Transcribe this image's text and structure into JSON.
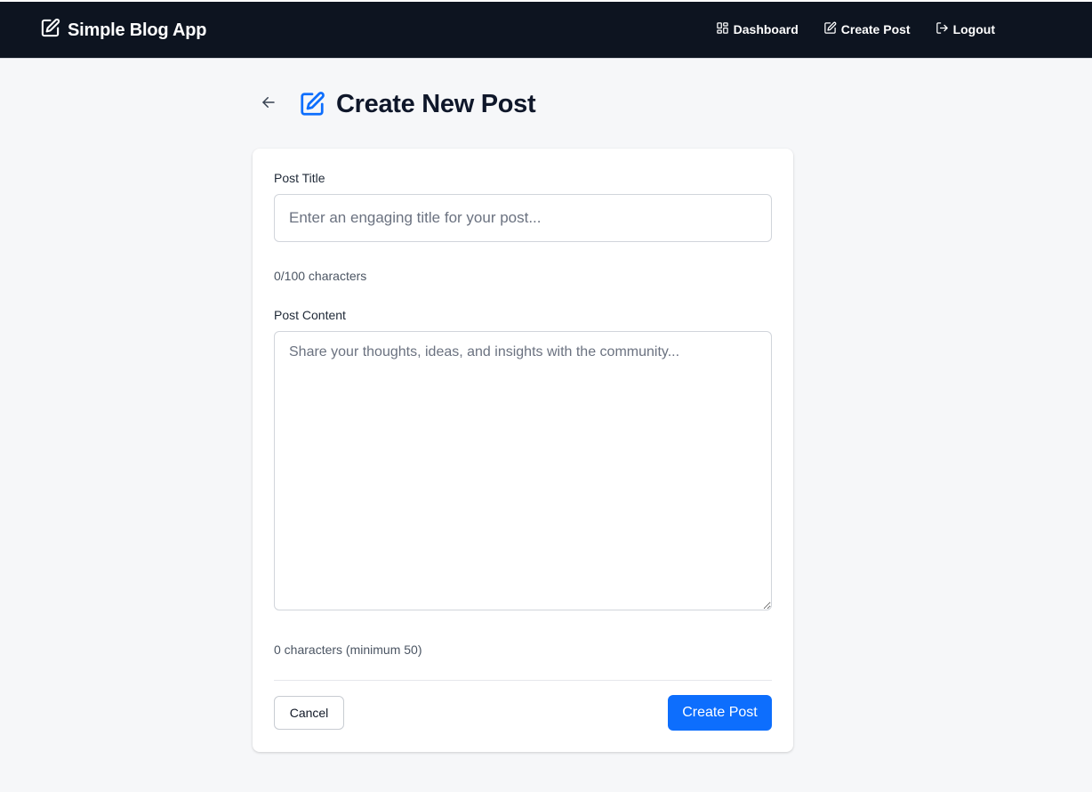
{
  "nav": {
    "brand": "Simple Blog App",
    "brand_icon": "edit-square-icon",
    "links": [
      {
        "label": "Dashboard",
        "icon": "dashboard-grid-icon"
      },
      {
        "label": "Create Post",
        "icon": "edit-square-icon"
      },
      {
        "label": "Logout",
        "icon": "logout-icon"
      }
    ],
    "background": "#0d1420"
  },
  "header": {
    "title": "Create New Post",
    "back_icon": "arrow-left-icon",
    "title_icon": "edit-square-icon",
    "accent": "#0d6efd"
  },
  "form": {
    "title_label": "Post Title",
    "title_value": "",
    "title_placeholder": "Enter an engaging title for your post...",
    "title_counter": "0/100 characters",
    "content_label": "Post Content",
    "content_value": "",
    "content_placeholder": "Share your thoughts, ideas, and insights with the community...",
    "content_counter": "0 characters (minimum 50)",
    "cancel_label": "Cancel",
    "submit_label": "Create Post"
  }
}
